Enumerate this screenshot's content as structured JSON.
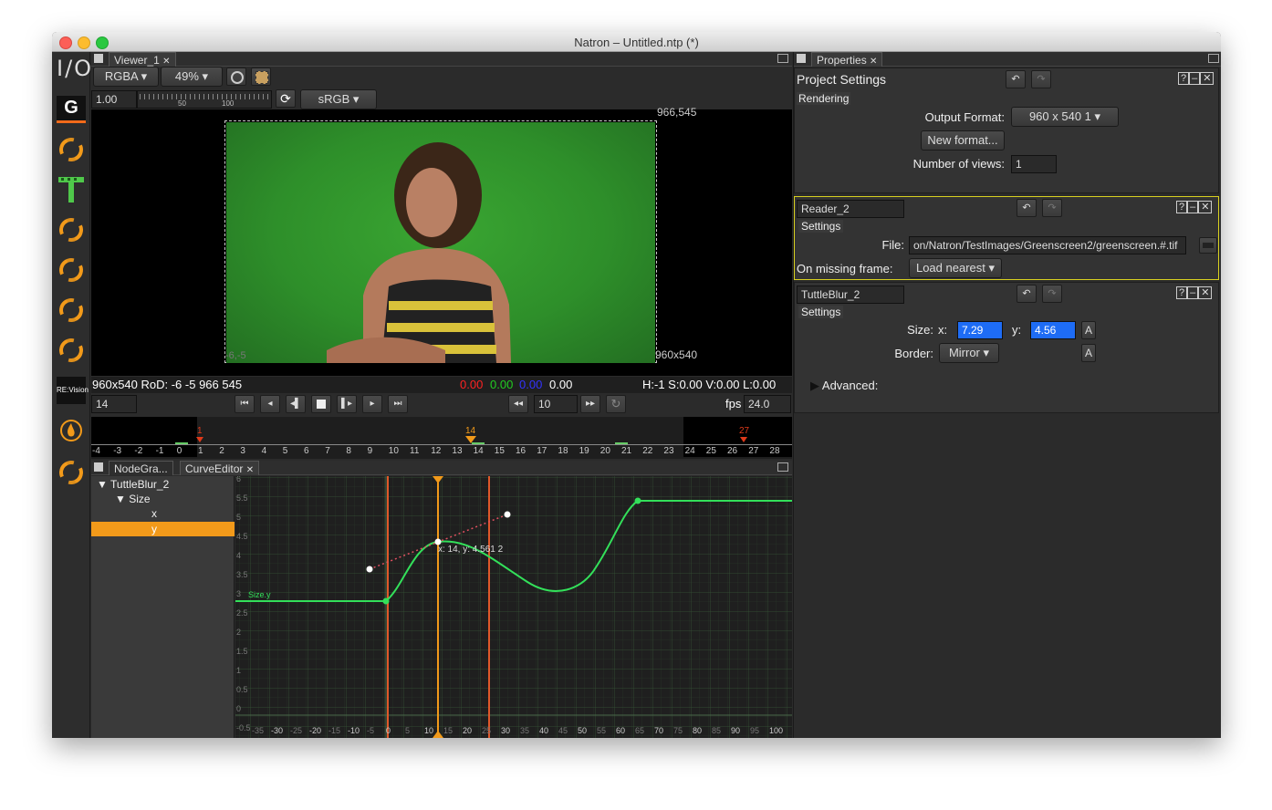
{
  "window": {
    "title": "Natron – Untitled.ntp (*)"
  },
  "toolbar_left": {
    "io_label": "I/O",
    "g_label": "G",
    "revision_label": "RE:Vision"
  },
  "viewer": {
    "tab": "Viewer_1",
    "channels": "RGBA",
    "zoom": "49%",
    "gain": "1.00",
    "slider_ticks": [
      "50",
      "100"
    ],
    "colorspace": "sRGB",
    "top_right_coord": "966,545",
    "bottom_left_coord": "-6,-5",
    "bottom_right_coord": "960x540",
    "info_left": "960x540 RoD: -6 -5 966 545",
    "info_r": "0.00",
    "info_g": "0.00",
    "info_b": "0.00",
    "info_a": "0.00",
    "info_right": "H:-1 S:0.00 V:0.00 L:0.00",
    "current_frame": "14",
    "increment": "10",
    "fps_label": "fps",
    "fps_value": "24.0"
  },
  "timeline": {
    "ticks": [
      "-4",
      "-3",
      "-2",
      "-1",
      "0",
      "1",
      "2",
      "3",
      "4",
      "5",
      "6",
      "7",
      "8",
      "9",
      "10",
      "11",
      "12",
      "13",
      "14",
      "15",
      "16",
      "17",
      "18",
      "19",
      "20",
      "21",
      "22",
      "23",
      "24",
      "25",
      "26",
      "27",
      "28"
    ],
    "start_marker": "1",
    "current_marker": "14",
    "end_marker": "27"
  },
  "curve_editor": {
    "tabs": [
      "NodeGra...",
      "CurveEditor"
    ],
    "tree": [
      "TuttleBlur_2",
      "Size",
      "x",
      "y"
    ],
    "curve_label": "Size.y",
    "tooltip": "x: 14, y: 4.561  2",
    "y_ticks": [
      "6",
      "5.5",
      "5",
      "4.5",
      "4",
      "3.5",
      "3",
      "2.5",
      "2",
      "1.5",
      "1",
      "0.5",
      "0",
      "-0.5"
    ],
    "x_ticks": [
      "-35",
      "-30",
      "-25",
      "-20",
      "-15",
      "-10",
      "-5",
      "0",
      "5",
      "10",
      "15",
      "20",
      "25",
      "30",
      "35",
      "40",
      "45",
      "50",
      "55",
      "60",
      "65",
      "70",
      "75",
      "80",
      "85",
      "90",
      "95",
      "100"
    ]
  },
  "properties": {
    "tab": "Properties",
    "project": {
      "title": "Project Settings",
      "section": "Rendering",
      "output_format_label": "Output Format:",
      "output_format_value": "960 x 540  1",
      "new_format_button": "New format...",
      "views_label": "Number of views:",
      "views_value": "1"
    },
    "reader": {
      "name": "Reader_2",
      "section": "Settings",
      "file_label": "File:",
      "file_value": "on/Natron/TestImages/Greenscreen2/greenscreen.#.tif",
      "missing_label": "On missing frame:",
      "missing_value": "Load nearest"
    },
    "blur": {
      "name": "TuttleBlur_2",
      "section": "Settings",
      "size_label": "Size:",
      "x_label": "x:",
      "x_value": "7.29",
      "y_label": "y:",
      "y_value": "4.56",
      "a_label": "A",
      "border_label": "Border:",
      "border_value": "Mirror",
      "advanced_label": "Advanced:"
    }
  },
  "colors": {
    "accent": "#f29a1a",
    "curve": "#33e05a",
    "selection": "#1e6cf5",
    "green_screen": "#2e8f2a"
  }
}
